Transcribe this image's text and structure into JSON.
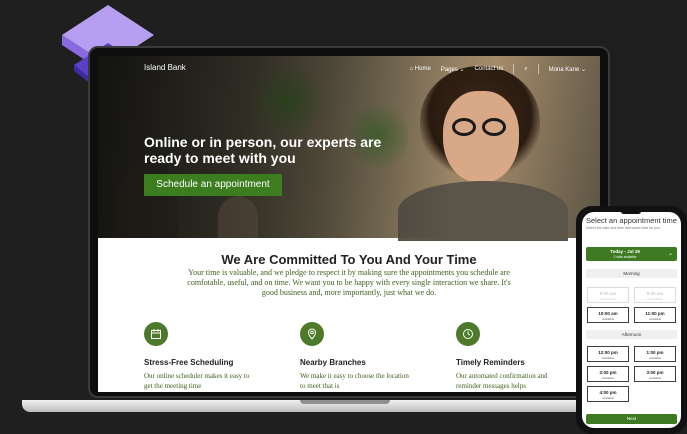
{
  "site": {
    "brand": "Island Bank",
    "nav": [
      "Home",
      "Pages",
      "Contact us"
    ],
    "user": "Mona Kane"
  },
  "hero": {
    "title": "Online or in person, our experts are ready to meet with you",
    "cta": "Schedule an appointment"
  },
  "commitment": {
    "title": "We Are Committed To You And Your Time",
    "body": "Your time is valuable, and we pledge to respect it by making sure the appointments you schedule are comfotable, useful, and on time. We want you to be happy with every single interaction we share. It's good business and, more importantly, just what we do."
  },
  "features": [
    {
      "title": "Stress-Free Scheduling",
      "desc": "Our online scheduler makes it easy to get the meeting time",
      "icon": "calendar-icon"
    },
    {
      "title": "Nearby Branches",
      "desc": "We make it easy to choose the location to meet that is",
      "icon": "location-pin-icon"
    },
    {
      "title": "Timely Reminders",
      "desc": "Our automated confirmation and reminder messages helps",
      "icon": "clock-icon"
    }
  ],
  "phone": {
    "title": "Select an appointment time",
    "subtitle": "Select the date and time that works best for you",
    "date": "Today - Jul 29",
    "date_sub": "2 slots available",
    "morning": "Morning",
    "afternoon": "Afternoon",
    "slots_morning": [
      {
        "time": "9:00 am",
        "status": "Unavailable"
      },
      {
        "time": "9:30 am",
        "status": "Unavailable"
      },
      {
        "time": "10:00 am",
        "status": "Available"
      },
      {
        "time": "11:00 pm",
        "status": "Available"
      }
    ],
    "slots_afternoon": [
      {
        "time": "12:00 pm",
        "status": "Available"
      },
      {
        "time": "1:00 pm",
        "status": "Available"
      },
      {
        "time": "2:00 pm",
        "status": "Available"
      },
      {
        "time": "3:00 pm",
        "status": "Available"
      },
      {
        "time": "4:00 pm",
        "status": "Available"
      }
    ],
    "next": "Next"
  },
  "colors": {
    "accent": "#3c7d1f",
    "background": "#1f1f1f"
  }
}
